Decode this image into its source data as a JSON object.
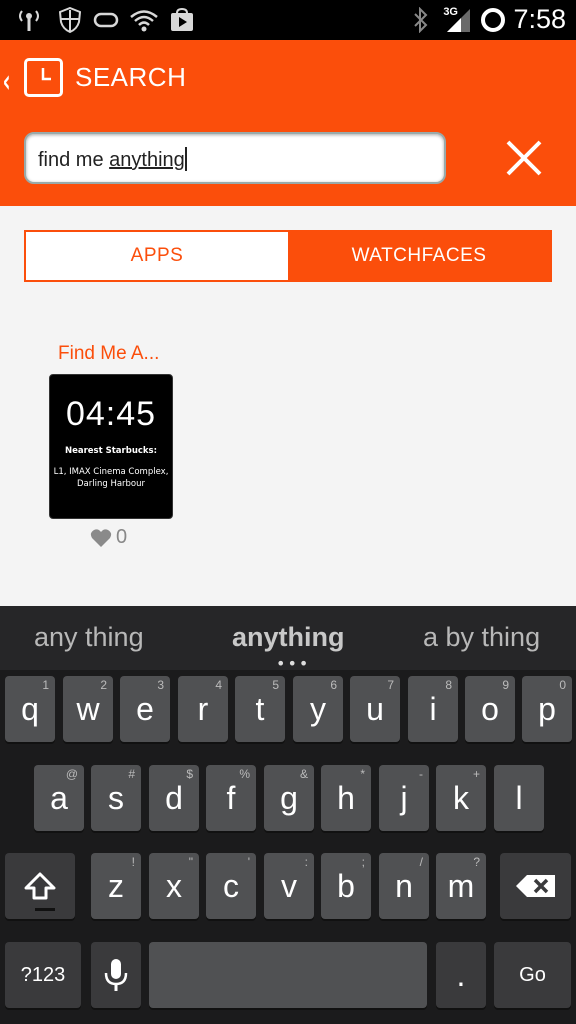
{
  "status_bar": {
    "network_type": "3G",
    "time": "7:58"
  },
  "header": {
    "title": "SEARCH"
  },
  "search": {
    "value_prefix": "find me ",
    "value_underlined": "anything"
  },
  "tabs": [
    {
      "label": "APPS",
      "selected": false
    },
    {
      "label": "WATCHFACES",
      "selected": true
    }
  ],
  "results": [
    {
      "title": "Find Me A...",
      "watch_time": "04:45",
      "watch_heading": "Nearest Starbucks:",
      "watch_detail_line1": "L1, IMAX Cinema Complex,",
      "watch_detail_line2": "Darling Harbour",
      "likes": "0"
    }
  ],
  "keyboard": {
    "suggestions": [
      "any thing",
      "anything",
      "a by thing"
    ],
    "row1": [
      {
        "key": "q",
        "hint": "1"
      },
      {
        "key": "w",
        "hint": "2"
      },
      {
        "key": "e",
        "hint": "3"
      },
      {
        "key": "r",
        "hint": "4"
      },
      {
        "key": "t",
        "hint": "5"
      },
      {
        "key": "y",
        "hint": "6"
      },
      {
        "key": "u",
        "hint": "7"
      },
      {
        "key": "i",
        "hint": "8"
      },
      {
        "key": "o",
        "hint": "9"
      },
      {
        "key": "p",
        "hint": "0"
      }
    ],
    "row2": [
      {
        "key": "a",
        "hint": "@"
      },
      {
        "key": "s",
        "hint": "#"
      },
      {
        "key": "d",
        "hint": "$"
      },
      {
        "key": "f",
        "hint": "%"
      },
      {
        "key": "g",
        "hint": "&"
      },
      {
        "key": "h",
        "hint": "*"
      },
      {
        "key": "j",
        "hint": "-"
      },
      {
        "key": "k",
        "hint": "+"
      },
      {
        "key": "l",
        "hint": ""
      }
    ],
    "row3": [
      {
        "key": "z",
        "hint": "!"
      },
      {
        "key": "x",
        "hint": "\""
      },
      {
        "key": "c",
        "hint": "'"
      },
      {
        "key": "v",
        "hint": ":"
      },
      {
        "key": "b",
        "hint": ";"
      },
      {
        "key": "n",
        "hint": "/"
      },
      {
        "key": "m",
        "hint": "?"
      }
    ],
    "symbols_label": "?123",
    "period_label": ".",
    "go_label": "Go"
  },
  "colors": {
    "accent": "#fb4e0b",
    "content_bg": "#f4f4f4",
    "keyboard_bg": "#1b1b1c",
    "key_bg": "#505153"
  },
  "icons": [
    "signal-tower-icon",
    "shield-icon",
    "infinity-icon",
    "wifi-icon",
    "play-store-icon",
    "bluetooth-icon",
    "cell-signal-icon",
    "sync-circle-icon",
    "back-chevron-icon",
    "app-logo-icon",
    "close-icon",
    "heart-icon",
    "shift-icon",
    "backspace-icon",
    "microphone-icon"
  ]
}
